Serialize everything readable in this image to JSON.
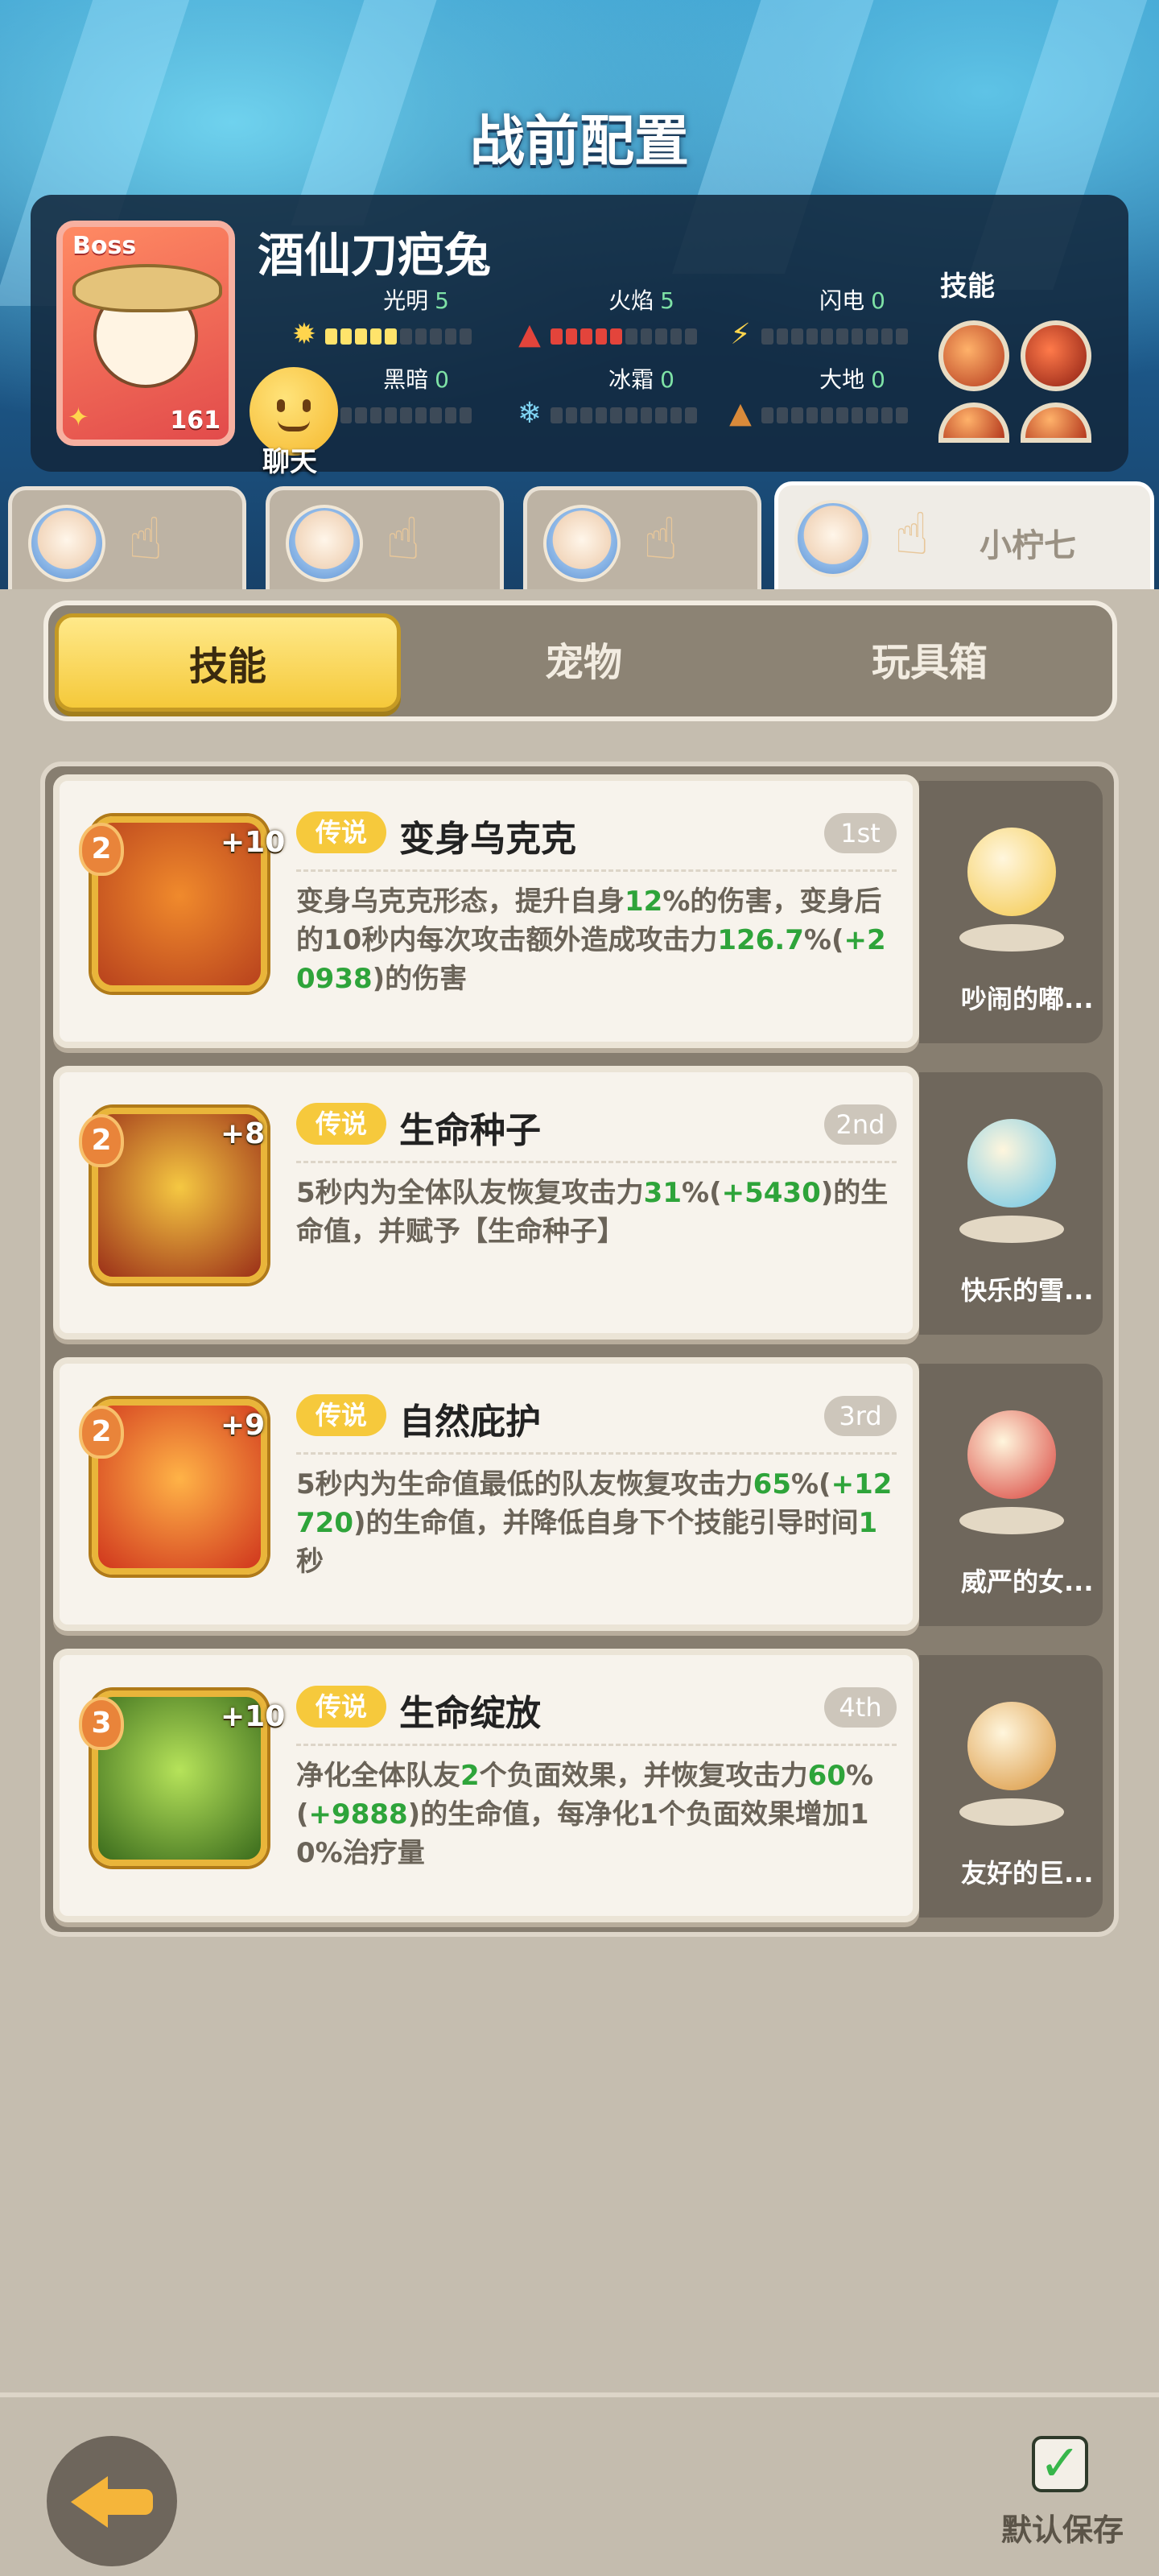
{
  "header": {
    "title": "战前配置"
  },
  "boss": {
    "tag": "Boss",
    "level": "161",
    "name": "酒仙刀疤兔",
    "stats": [
      {
        "label": "光明",
        "value": "5",
        "icon": "sun-icon",
        "filled": 5,
        "kind": "light"
      },
      {
        "label": "火焰",
        "value": "5",
        "icon": "flame-icon",
        "filled": 5,
        "kind": "fire"
      },
      {
        "label": "闪电",
        "value": "0",
        "icon": "lightning-icon",
        "filled": 0,
        "kind": "light"
      },
      {
        "label": "黑暗",
        "value": "0",
        "icon": "dark-icon",
        "filled": 0,
        "kind": "light"
      },
      {
        "label": "冰霜",
        "value": "0",
        "icon": "snowflake-icon",
        "filled": 0,
        "kind": "light"
      },
      {
        "label": "大地",
        "value": "0",
        "icon": "earth-icon",
        "filled": 0,
        "kind": "light"
      }
    ],
    "skills_label": "技能"
  },
  "chat": {
    "label": "聊天"
  },
  "hero_tabs": [
    {
      "name": ""
    },
    {
      "name": ""
    },
    {
      "name": ""
    },
    {
      "name": "小柠七",
      "active": true
    }
  ],
  "categories": [
    {
      "label": "技能",
      "active": true
    },
    {
      "label": "宠物"
    },
    {
      "label": "玩具箱"
    }
  ],
  "skills": [
    {
      "rank": "2",
      "plus": "+10",
      "rarity": "传说",
      "title": "变身乌克克",
      "order": "1st",
      "desc_parts": [
        {
          "t": "变身乌克克形态，提升自身"
        },
        {
          "t": "12",
          "hl": true
        },
        {
          "t": "%的伤害，变身后的10秒内每次攻击额外造成攻击力"
        },
        {
          "t": "126.7",
          "hl": true
        },
        {
          "t": "%("
        },
        {
          "t": "+20938",
          "hl": true
        },
        {
          "t": ")的伤害"
        }
      ],
      "icon_colors": [
        "#f08a2c",
        "#b8421d"
      ]
    },
    {
      "rank": "2",
      "plus": "+8",
      "rarity": "传说",
      "title": "生命种子",
      "order": "2nd",
      "desc_parts": [
        {
          "t": "5秒内为全体队友恢复攻击力"
        },
        {
          "t": "31",
          "hl": true
        },
        {
          "t": "%("
        },
        {
          "t": "+5430",
          "hl": true
        },
        {
          "t": ")的生命值，并赋予【生命种子】"
        }
      ],
      "icon_colors": [
        "#f5c842",
        "#9b2f18"
      ]
    },
    {
      "rank": "2",
      "plus": "+9",
      "rarity": "传说",
      "title": "自然庇护",
      "order": "3rd",
      "desc_parts": [
        {
          "t": "5秒内为生命值最低的队友恢复攻击力"
        },
        {
          "t": "65",
          "hl": true
        },
        {
          "t": "%("
        },
        {
          "t": "+12720",
          "hl": true
        },
        {
          "t": ")的生命值，并降低自身下个技能引导时间"
        },
        {
          "t": "1",
          "hl": true
        },
        {
          "t": "秒"
        }
      ],
      "icon_colors": [
        "#ffb347",
        "#d0361d"
      ]
    },
    {
      "rank": "3",
      "plus": "+10",
      "rarity": "传说",
      "title": "生命绽放",
      "order": "4th",
      "desc_parts": [
        {
          "t": "净化全体队友"
        },
        {
          "t": "2",
          "hl": true
        },
        {
          "t": "个负面效果，并恢复攻击力"
        },
        {
          "t": "60",
          "hl": true
        },
        {
          "t": "%("
        },
        {
          "t": "+9888",
          "hl": true
        },
        {
          "t": ")的生命值，每净化1个负面效果增加10%治疗量"
        }
      ],
      "icon_colors": [
        "#b6e35a",
        "#3a6b1c"
      ]
    }
  ],
  "pets": [
    {
      "name": "吵闹的嘟...",
      "color": "#f4c84a"
    },
    {
      "name": "快乐的雪...",
      "color": "#6cc6e6"
    },
    {
      "name": "威严的女...",
      "color": "#d8403a"
    },
    {
      "name": "友好的巨...",
      "color": "#d9943b"
    }
  ],
  "footer": {
    "save_label": "默认保存"
  }
}
